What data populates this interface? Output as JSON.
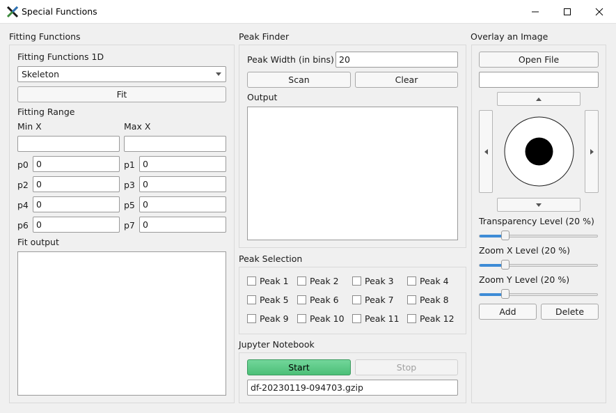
{
  "window": {
    "title": "Special Functions",
    "controls": [
      "minimize",
      "maximize",
      "close"
    ]
  },
  "fitting": {
    "group_title": "Fitting Functions",
    "subtitle": "Fitting Functions 1D",
    "function_select": "Skeleton",
    "fit_button": "Fit",
    "range_title": "Fitting Range",
    "min_x_label": "Min X",
    "max_x_label": "Max X",
    "min_x_value": "",
    "max_x_value": "",
    "params": [
      {
        "label": "p0",
        "value": "0"
      },
      {
        "label": "p1",
        "value": "0"
      },
      {
        "label": "p2",
        "value": "0"
      },
      {
        "label": "p3",
        "value": "0"
      },
      {
        "label": "p4",
        "value": "0"
      },
      {
        "label": "p5",
        "value": "0"
      },
      {
        "label": "p6",
        "value": "0"
      },
      {
        "label": "p7",
        "value": "0"
      }
    ],
    "output_label": "Fit output"
  },
  "peak_finder": {
    "group_title": "Peak Finder",
    "width_label": "Peak Width (in bins)",
    "width_value": "20",
    "scan_button": "Scan",
    "clear_button": "Clear",
    "output_label": "Output"
  },
  "peak_selection": {
    "group_title": "Peak Selection",
    "peaks": [
      "Peak 1",
      "Peak 2",
      "Peak 3",
      "Peak 4",
      "Peak 5",
      "Peak 6",
      "Peak 7",
      "Peak 8",
      "Peak 9",
      "Peak 10",
      "Peak 11",
      "Peak 12"
    ]
  },
  "jupyter": {
    "group_title": "Jupyter Notebook",
    "start_button": "Start",
    "stop_button": "Stop",
    "file_value": "df-20230119-094703.gzip"
  },
  "overlay": {
    "group_title": "Overlay an Image",
    "open_button": "Open File",
    "file_value": "",
    "sliders": [
      {
        "label": "Transparency Level (20 %)",
        "value": 20
      },
      {
        "label": "Zoom X Level (20 %)",
        "value": 20
      },
      {
        "label": "Zoom Y Level (20 %)",
        "value": 20
      }
    ],
    "add_button": "Add",
    "delete_button": "Delete"
  },
  "colors": {
    "accent": "#3d8bd6",
    "start_button": "#5cc986"
  }
}
